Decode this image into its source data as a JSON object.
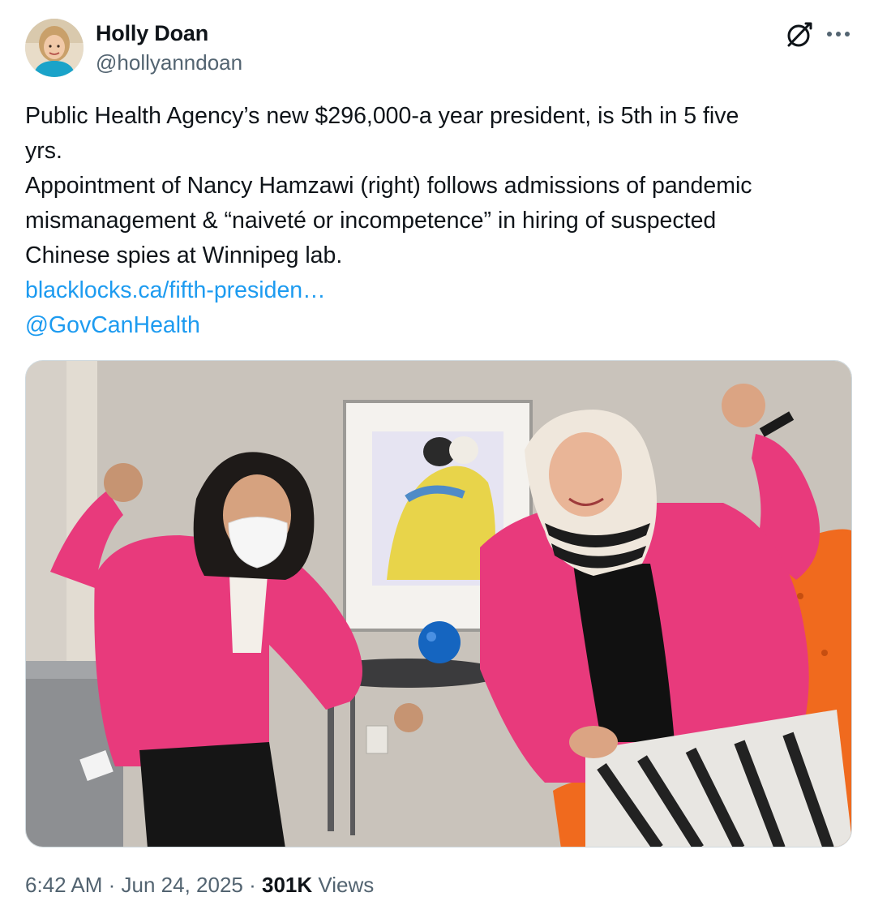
{
  "author": {
    "name": "Holly Doan",
    "handle": "@hollyanndoan"
  },
  "icons": {
    "grok": "grok-icon",
    "more": "more-icon"
  },
  "tweet": {
    "lines": [
      "Public Health Agency’s new $296,000-a year president, is 5th in 5 five",
      "yrs.",
      "Appointment of Nancy Hamzawi (right) follows admissions of pandemic",
      "mismanagement & “naiveté or incompetence” in hiring of suspected",
      "Chinese spies at Winnipeg lab."
    ],
    "link": "blacklocks.ca/fifth-presiden…",
    "mention": "@GovCanHealth"
  },
  "meta": {
    "time": "6:42 AM",
    "sep1": " · ",
    "date": "Jun 24, 2025",
    "sep2": " · ",
    "views_count": "301K",
    "views_label": " Views"
  },
  "colors": {
    "link": "#1d9bf0",
    "secondary": "#536471",
    "text": "#0f1419",
    "jacket_pink": "#e83a7c",
    "chair_orange": "#f06a1e"
  }
}
